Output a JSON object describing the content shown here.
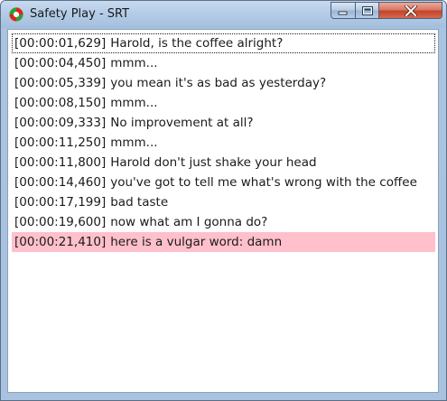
{
  "window": {
    "title": "Safety Play - SRT",
    "colors": {
      "flagged_row": "#ffc0cb",
      "close_button": "#c2432a"
    }
  },
  "subtitles": [
    {
      "time": "[00:00:01,629]",
      "text": "Harold, is the coffee alright?",
      "focused": true,
      "flagged": false
    },
    {
      "time": "[00:00:04,450]",
      "text": "mmm...",
      "focused": false,
      "flagged": false
    },
    {
      "time": "[00:00:05,339]",
      "text": "you mean it's as bad as yesterday?",
      "focused": false,
      "flagged": false
    },
    {
      "time": "[00:00:08,150]",
      "text": "mmm...",
      "focused": false,
      "flagged": false
    },
    {
      "time": "[00:00:09,333]",
      "text": "No improvement at all?",
      "focused": false,
      "flagged": false
    },
    {
      "time": "[00:00:11,250]",
      "text": "mmm...",
      "focused": false,
      "flagged": false
    },
    {
      "time": "[00:00:11,800]",
      "text": "Harold don't just shake your head",
      "focused": false,
      "flagged": false
    },
    {
      "time": "[00:00:14,460]",
      "text": "you've got to tell me what's wrong with the coffee",
      "focused": false,
      "flagged": false
    },
    {
      "time": "[00:00:17,199]",
      "text": "bad taste",
      "focused": false,
      "flagged": false
    },
    {
      "time": "[00:00:19,600]",
      "text": "now what am I gonna do?",
      "focused": false,
      "flagged": false
    },
    {
      "time": "[00:00:21,410]",
      "text": "here is a vulgar word: damn",
      "focused": false,
      "flagged": true
    }
  ]
}
